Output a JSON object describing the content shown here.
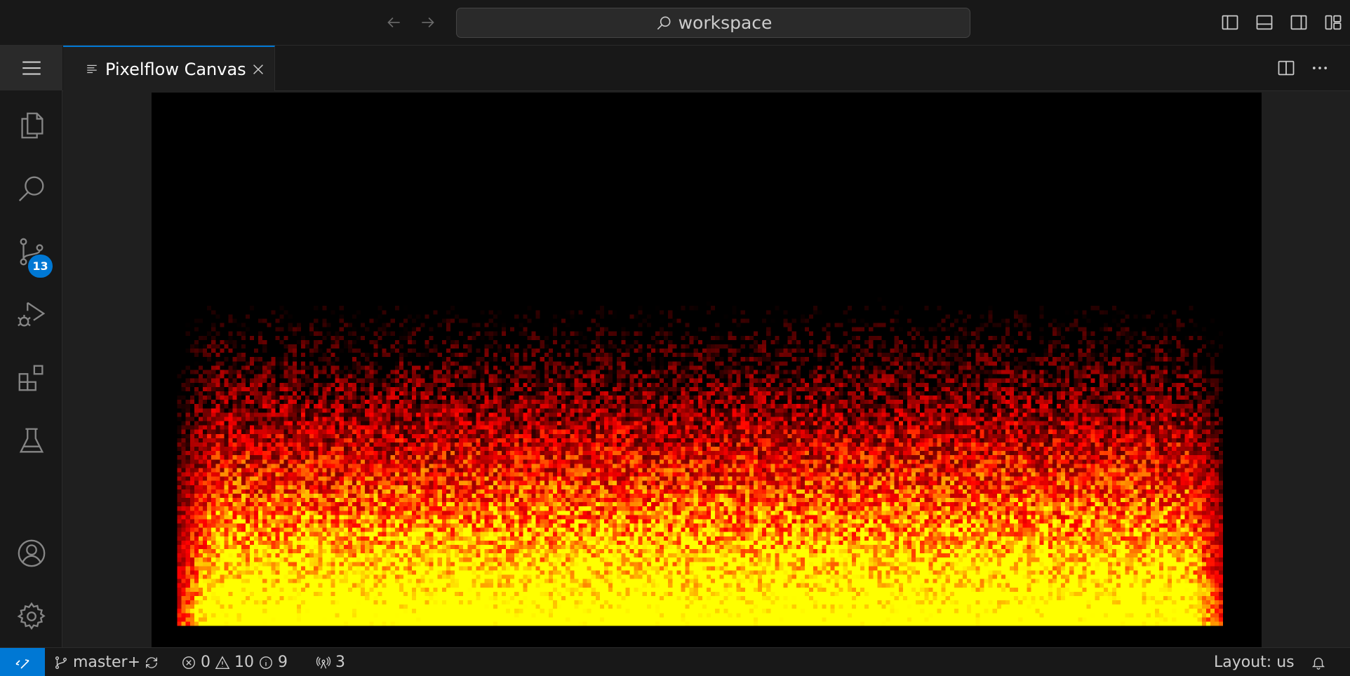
{
  "titlebar": {
    "search_text": "workspace"
  },
  "activity_bar": {
    "items": [
      {
        "name": "explorer",
        "icon": "files-icon"
      },
      {
        "name": "search",
        "icon": "search-icon"
      },
      {
        "name": "source-control",
        "icon": "source-control-icon",
        "badge": "13"
      },
      {
        "name": "run-and-debug",
        "icon": "run-debug-icon"
      },
      {
        "name": "extensions",
        "icon": "extensions-icon"
      },
      {
        "name": "testing",
        "icon": "beaker-icon"
      }
    ],
    "bottom_items": [
      {
        "name": "accounts",
        "icon": "account-icon"
      },
      {
        "name": "manage",
        "icon": "gear-icon"
      }
    ]
  },
  "tabs": [
    {
      "label": "Pixelflow Canvas",
      "active": true
    }
  ],
  "canvas": {
    "content": "doom-fire-simulation",
    "palette": [
      "#000000",
      "#ff0000",
      "#ffff00"
    ]
  },
  "statusbar": {
    "branch": "master+",
    "errors": "0",
    "warnings": "10",
    "infos": "9",
    "ports": "3",
    "layout": "Layout: us"
  },
  "colors": {
    "accent": "#0078d4",
    "background": "#181818",
    "editor_background": "#1f1f1f"
  }
}
